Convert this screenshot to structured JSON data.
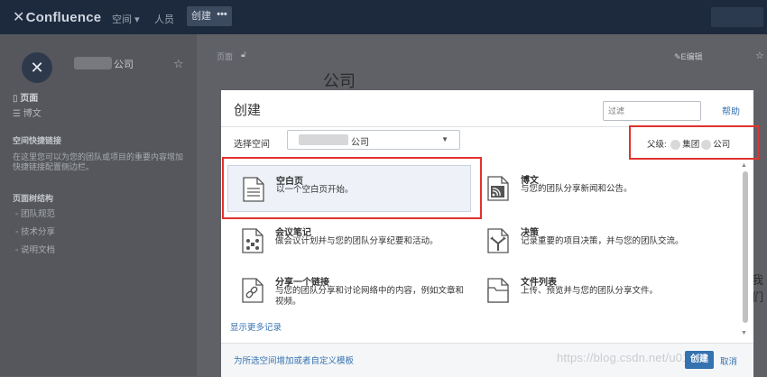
{
  "topbar": {
    "logo": "Confluence",
    "nav_spaces": "空间",
    "nav_spaces_caret": "▾",
    "nav_people": "人员",
    "create": "创建",
    "more": "•••"
  },
  "sidebar": {
    "space_name_suffix": "公司",
    "pages": "页面",
    "blog": "博文",
    "shortcuts_heading": "空间快捷链接",
    "shortcuts_text": "在这里您可以为您的团队或项目的重要内容增加快捷链接配置侧边栏。",
    "tree_heading": "页面树结构",
    "tree_items": [
      "团队规范",
      "技术分享",
      "说明文档"
    ]
  },
  "background_page": {
    "breadcrumb": "页面",
    "edit": "E编辑",
    "title": "公司",
    "overflow_text": "我们"
  },
  "modal": {
    "title": "创建",
    "filter_placeholder": "过滤",
    "help": "帮助",
    "select_space_label": "选择空间",
    "selected_space": "公司",
    "parent_label": "父级: ",
    "parent_mid": "集团",
    "parent_end": "公司",
    "templates": [
      {
        "name": "空白页",
        "desc": "以一个空白页开始。",
        "icon": "blank-page-icon"
      },
      {
        "name": "博文",
        "desc": "与您的团队分享新闻和公告。",
        "icon": "blog-rss-icon"
      },
      {
        "name": "会议笔记",
        "desc": "做会议计划并与您的团队分享纪要和活动。",
        "icon": "meeting-notes-icon"
      },
      {
        "name": "决策",
        "desc": "记录重要的项目决策，并与您的团队交流。",
        "icon": "decision-icon"
      },
      {
        "name": "分享一个链接",
        "desc": "与您的团队分享和讨论网络中的内容，例如文章和视频。",
        "icon": "link-icon"
      },
      {
        "name": "文件列表",
        "desc": "上传、预览并与您的团队分享文件。",
        "icon": "file-list-icon"
      }
    ],
    "show_more": "显示更多记录",
    "footer_template_link": "为所选空间增加或者自定义模板",
    "watermark": "https://blog.csdn.net/u01",
    "create_button": "创建",
    "cancel": "取消"
  },
  "colors": {
    "highlight_box": "#e2322f",
    "link": "#3572b0",
    "topbar": "#1d2a3e"
  }
}
